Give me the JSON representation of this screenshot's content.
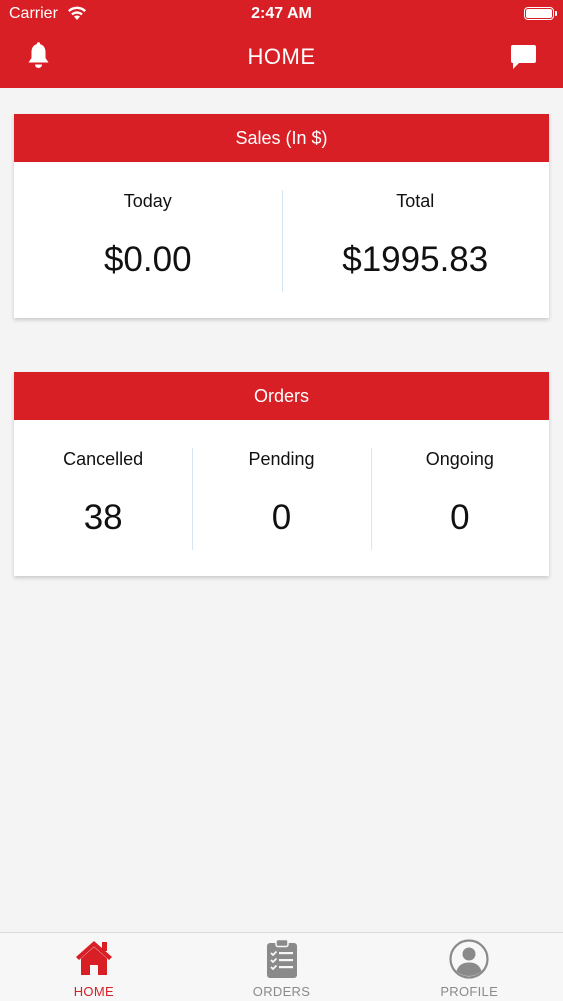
{
  "status_bar": {
    "carrier": "Carrier",
    "time": "2:47 AM"
  },
  "header": {
    "title": "HOME",
    "left_icon": "bell-icon",
    "right_icon": "chat-icon"
  },
  "sales_card": {
    "title": "Sales (In $)",
    "today_label": "Today",
    "today_value": "$0.00",
    "total_label": "Total",
    "total_value": "$1995.83"
  },
  "orders_card": {
    "title": "Orders",
    "cancelled_label": "Cancelled",
    "cancelled_value": "38",
    "pending_label": "Pending",
    "pending_value": "0",
    "ongoing_label": "Ongoing",
    "ongoing_value": "0"
  },
  "tabbar": {
    "tabs": [
      {
        "label": "HOME",
        "icon": "home-icon",
        "active": true
      },
      {
        "label": "ORDERS",
        "icon": "clipboard-list-icon",
        "active": false
      },
      {
        "label": "PROFILE",
        "icon": "user-circle-icon",
        "active": false
      }
    ]
  },
  "colors": {
    "brand": "#d91f26",
    "inactive": "#8a8a8a",
    "divider": "#d6e6f2"
  }
}
